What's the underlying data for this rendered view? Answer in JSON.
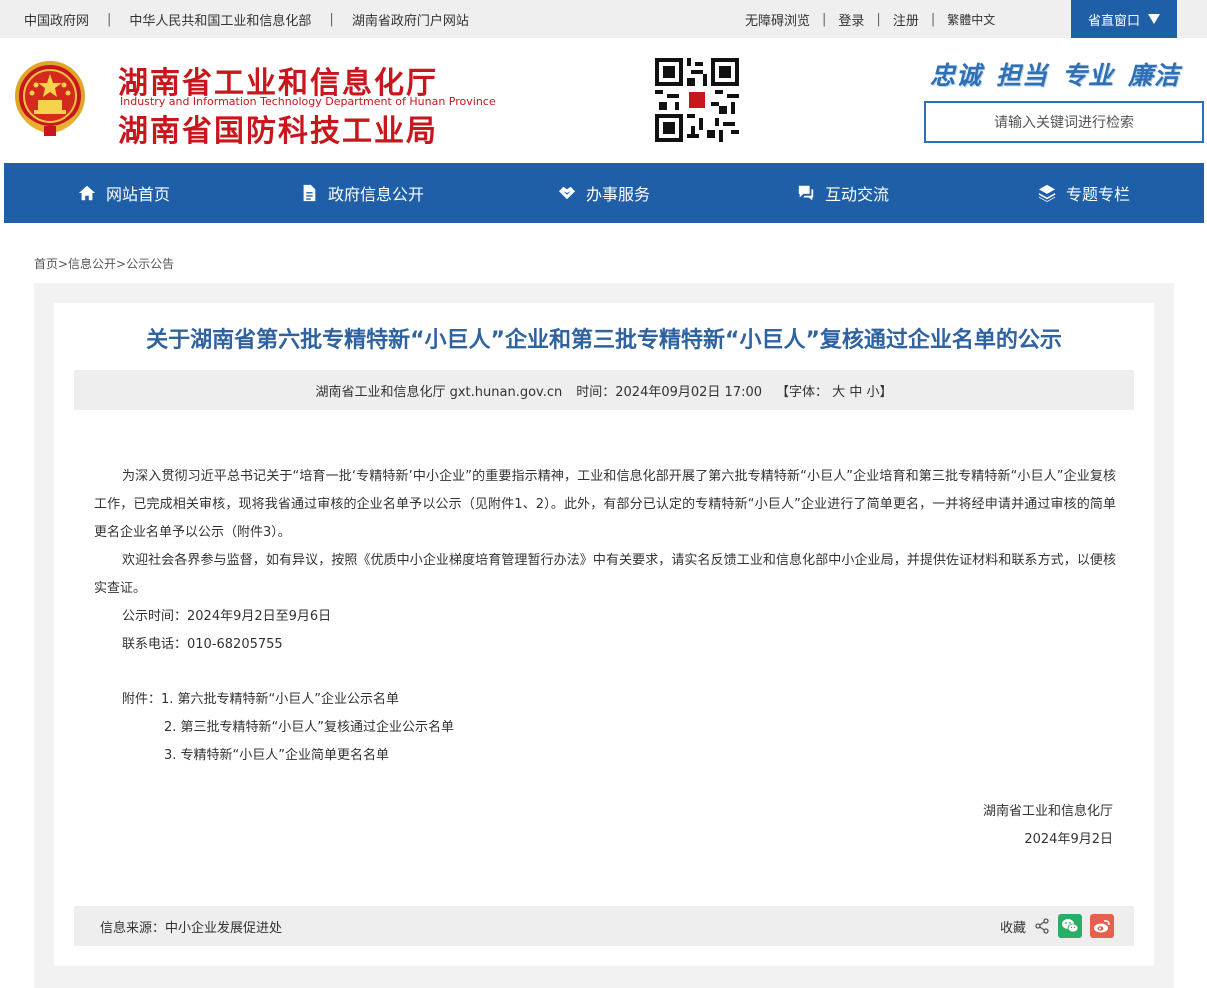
{
  "topbar": {
    "links": [
      "中国政府网",
      "中华人民共和国工业和信息化部",
      "湖南省政府门户网站"
    ],
    "accessible": "无障碍浏览",
    "login": "登录",
    "register": "注册",
    "traditional": "繁體中文",
    "province_window": "省直窗口"
  },
  "header": {
    "title1": "湖南省工业和信息化厅",
    "title_en": "Industry and Information Technology Department of Hunan Province",
    "title2": "湖南省国防科技工业局",
    "slogan": [
      "忠诚",
      "担当",
      "专业",
      "廉洁"
    ],
    "search_placeholder": "请输入关键词进行检索"
  },
  "nav": {
    "items": [
      {
        "label": "网站首页",
        "icon": "home-icon"
      },
      {
        "label": "政府信息公开",
        "icon": "document-icon"
      },
      {
        "label": "办事服务",
        "icon": "handshake-icon"
      },
      {
        "label": "互动交流",
        "icon": "chat-icon"
      },
      {
        "label": "专题专栏",
        "icon": "layers-icon"
      }
    ]
  },
  "breadcrumb": "首页>信息公开>公示公告",
  "article": {
    "title": "关于湖南省第六批专精特新“小巨人”企业和第三批专精特新“小巨人”复核通过企业名单的公示",
    "meta": {
      "publisher": "湖南省工业和信息化厅 gxt.hunan.gov.cn",
      "time": "时间：2024年09月02日 17:00",
      "font_label": "【字体：",
      "font_large": "大",
      "font_medium": "中",
      "font_small": "小",
      "font_close": "】"
    },
    "paragraphs": [
      "为深入贯彻习近平总书记关于“培育一批‘专精特新’中小企业”的重要指示精神，工业和信息化部开展了第六批专精特新“小巨人”企业培育和第三批专精特新“小巨人”企业复核工作，已完成相关审核，现将我省通过审核的企业名单予以公示（见附件1、2）。此外，有部分已认定的专精特新“小巨人”企业进行了简单更名，一并将经申请并通过审核的简单更名企业名单予以公示（附件3）。",
      "欢迎社会各界参与监督，如有异议，按照《优质中小企业梯度培育管理暂行办法》中有关要求，请实名反馈工业和信息化部中小企业局，并提供佐证材料和联系方式，以便核实查证。",
      "公示时间：2024年9月2日至9月6日",
      "联系电话：010-68205755"
    ],
    "attachments_label": "附件：",
    "attachments": [
      "1. 第六批专精特新“小巨人”企业公示名单",
      "2. 第三批专精特新“小巨人”复核通过企业公示名单",
      "3. 专精特新“小巨人”企业简单更名名单"
    ],
    "sign_org": "湖南省工业和信息化厅",
    "sign_date": "2024年9月2日",
    "source": "信息来源：中小企业发展促进处",
    "collect": "收藏"
  },
  "colors": {
    "brand_red": "#c8161d",
    "nav_blue": "#1e5fa8",
    "title_blue": "#2f63a0",
    "wechat_green": "#2aae67",
    "weibo_red": "#e6614c"
  }
}
